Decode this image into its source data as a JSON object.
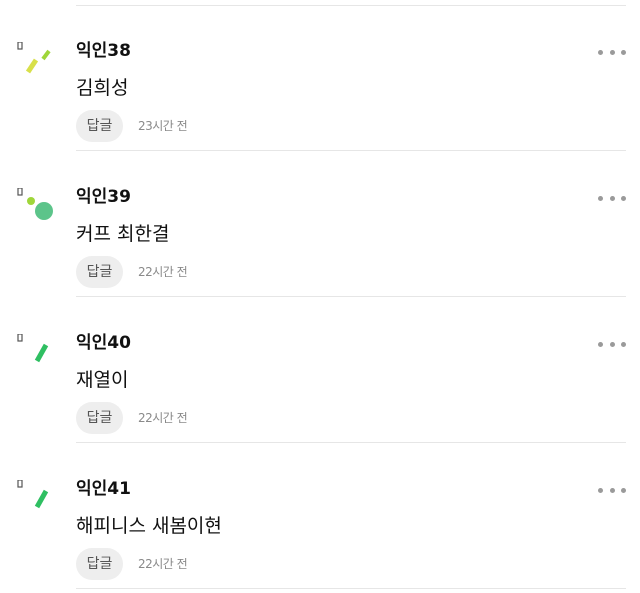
{
  "comments": [
    {
      "nickname": "익인38",
      "body": "김희성",
      "reply_label": "답글",
      "time": "23시간 전",
      "avatar": "avatar-lines-yellow-green"
    },
    {
      "nickname": "익인39",
      "body": "커프 최한결",
      "reply_label": "답글",
      "time": "22시간 전",
      "avatar": "avatar-dots-green"
    },
    {
      "nickname": "익인40",
      "body": "재열이",
      "reply_label": "답글",
      "time": "22시간 전",
      "avatar": "avatar-line-green"
    },
    {
      "nickname": "익인41",
      "body": "해피니스 새봄이현",
      "reply_label": "답글",
      "time": "22시간 전",
      "avatar": "avatar-line-green"
    }
  ],
  "colors": {
    "avatar_green": "#2fbf62",
    "avatar_light_green": "#9fd63a",
    "avatar_yellow": "#d8e04a",
    "avatar_mint": "#5cc48a",
    "reply_bg": "#eeeeee",
    "muted_text": "#8a8a8a",
    "divider": "#e6e6e6"
  }
}
